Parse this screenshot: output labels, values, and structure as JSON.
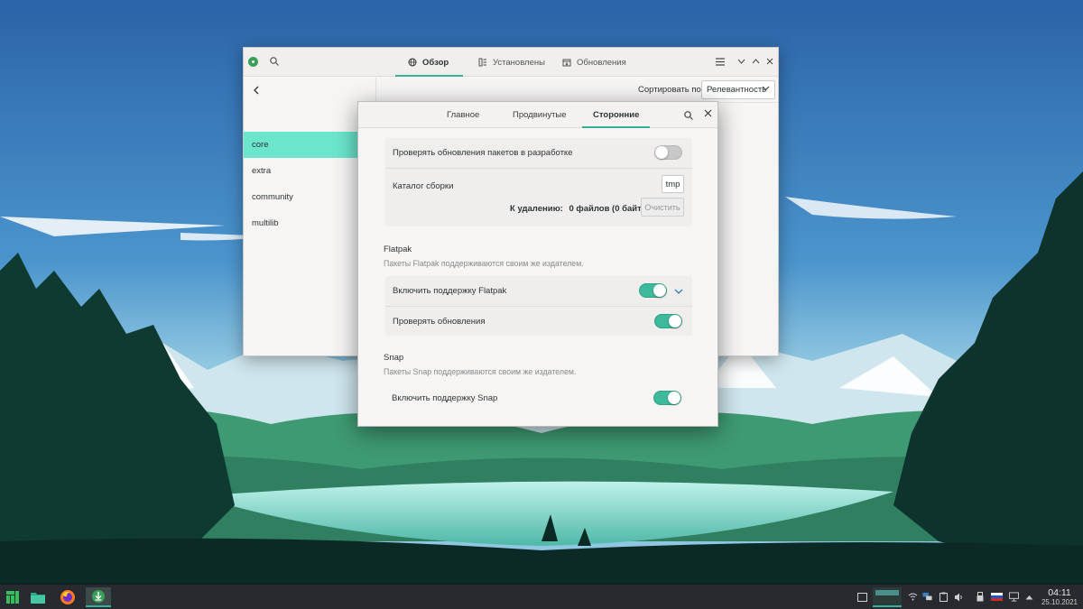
{
  "main_window": {
    "tabs": [
      {
        "label": "Обзор",
        "icon": "globe-icon",
        "active": true
      },
      {
        "label": "Установлены",
        "icon": "installed-icon",
        "active": false
      },
      {
        "label": "Обновления",
        "icon": "updates-icon",
        "active": false
      }
    ],
    "sidebar": {
      "items": [
        {
          "label": "core",
          "active": true
        },
        {
          "label": "extra",
          "active": false
        },
        {
          "label": "community",
          "active": false
        },
        {
          "label": "multilib",
          "active": false
        }
      ]
    },
    "sort_label": "Сортировать по",
    "sort_value": "Релевантность"
  },
  "dialog": {
    "tabs": [
      {
        "label": "Главное",
        "active": false
      },
      {
        "label": "Продвинутые",
        "active": false
      },
      {
        "label": "Сторонние",
        "active": true
      }
    ],
    "aur": {
      "check_dev_updates_label": "Проверять обновления пакетов в разработке",
      "check_dev_updates_on": false,
      "build_dir_label": "Каталог сборки",
      "build_dir_value": "tmp",
      "to_delete_label": "К удалению:",
      "to_delete_value": "0 файлов  (0 байт)",
      "clear_button": "Очистить"
    },
    "flatpak": {
      "title": "Flatpak",
      "description": "Пакеты Flatpak поддерживаются своим же издателем.",
      "enable_label": "Включить поддержку Flatpak",
      "enable_on": true,
      "check_updates_label": "Проверять обновления",
      "check_updates_on": true
    },
    "snap": {
      "title": "Snap",
      "description": "Пакеты Snap поддерживаются своим же издателем.",
      "enable_label": "Включить поддержку Snap",
      "enable_on": true
    }
  },
  "taskbar": {
    "launchers": [
      "manjaro-logo-icon",
      "file-manager-icon",
      "firefox-icon",
      "pamac-icon"
    ],
    "clock_time": "04:11",
    "clock_date": "25.10.2021",
    "accent_color": "#35b09c"
  }
}
